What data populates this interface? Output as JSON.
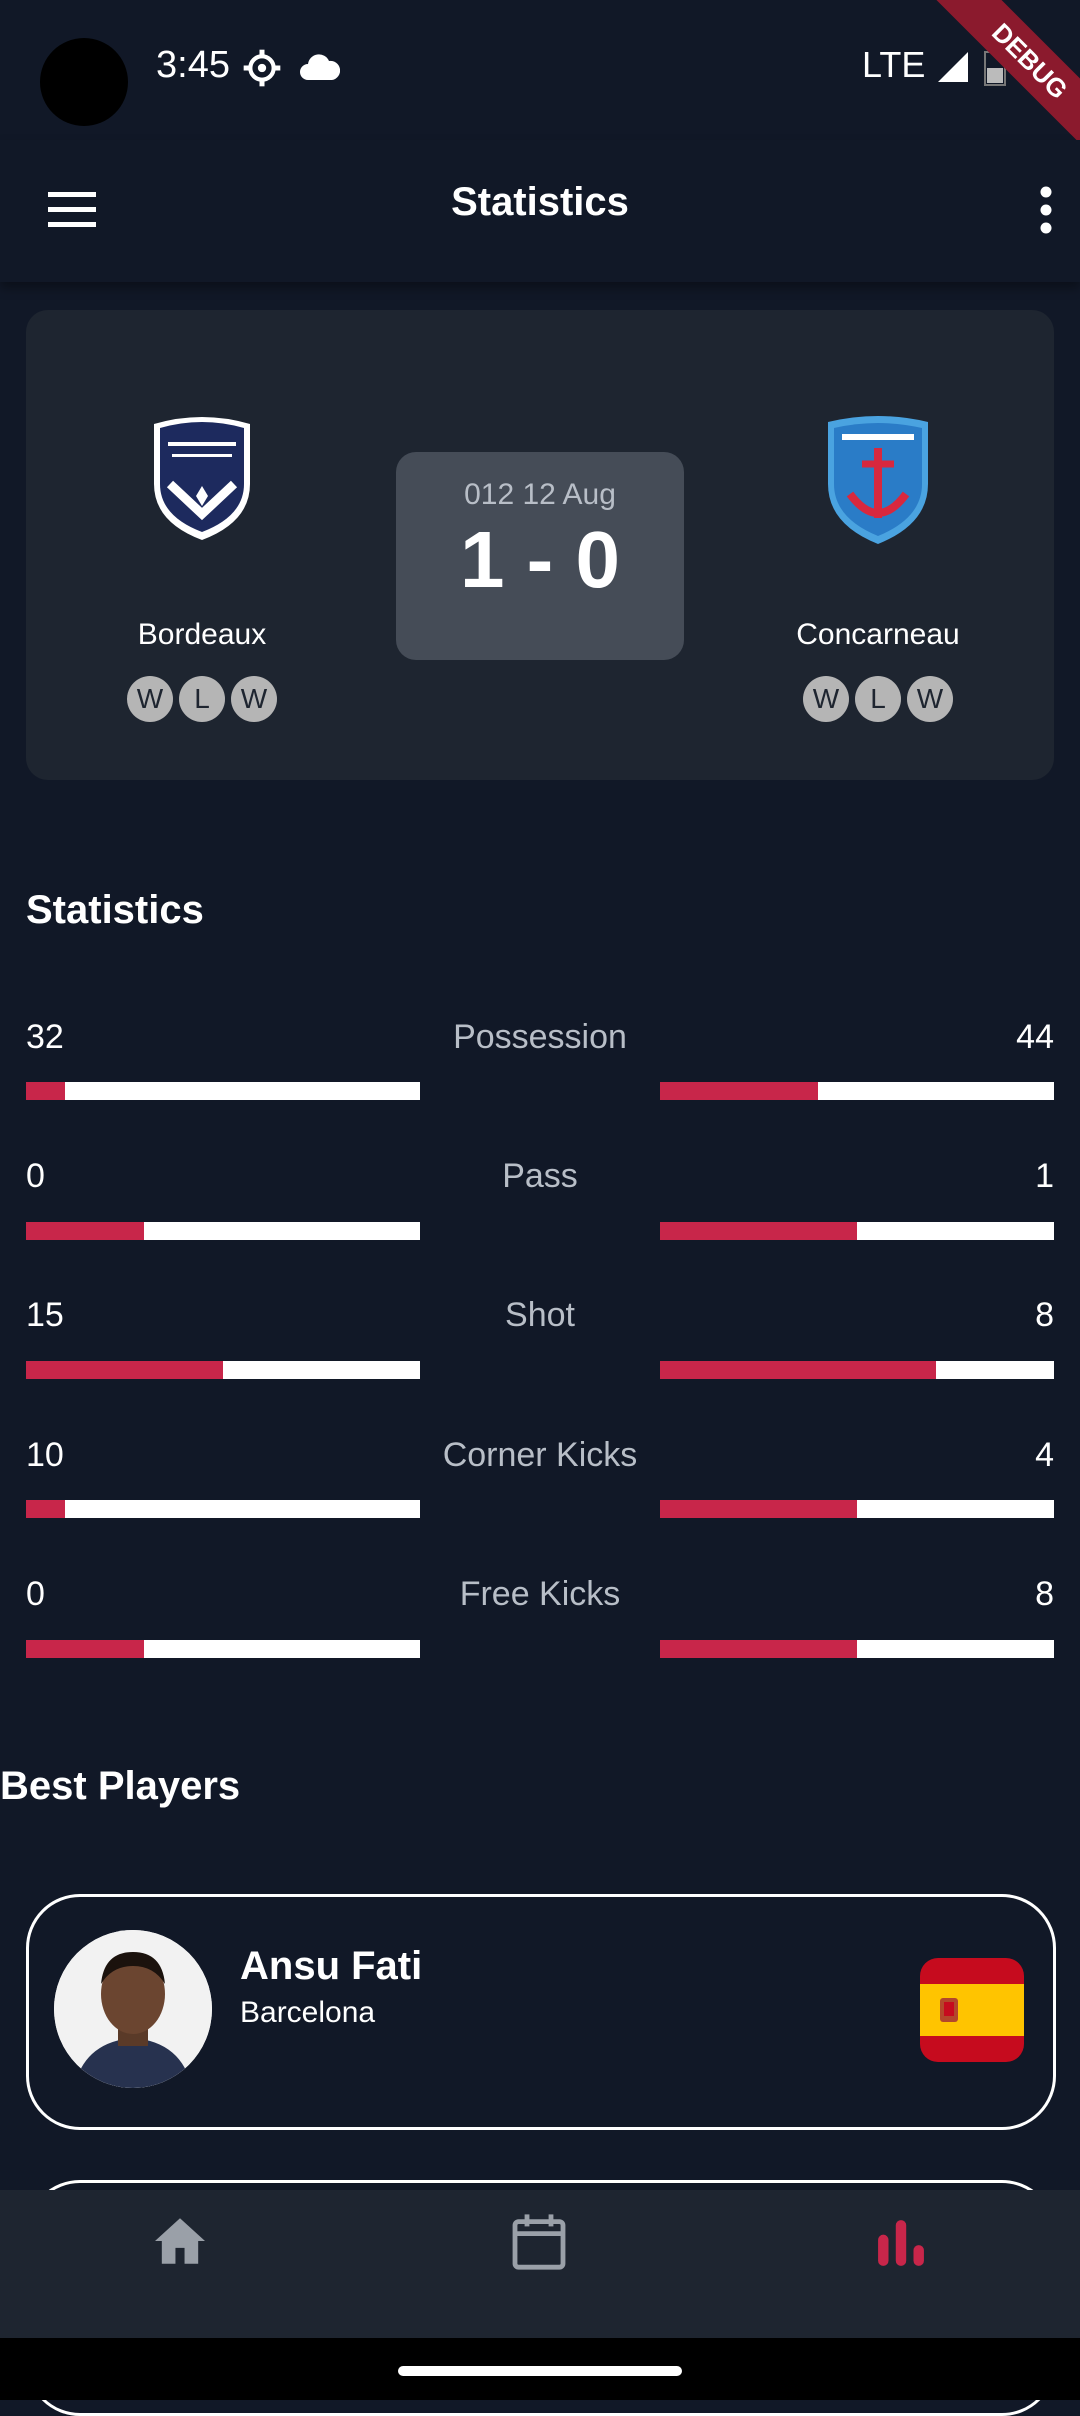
{
  "status_bar": {
    "time": "3:45",
    "network": "LTE",
    "debug_label": "DEBUG"
  },
  "app_bar": {
    "title": "Statistics"
  },
  "match": {
    "date": "012 12 Aug",
    "score": "1 - 0",
    "home": {
      "name": "Bordeaux",
      "form": [
        "W",
        "L",
        "W"
      ]
    },
    "away": {
      "name": "Concarneau",
      "form": [
        "W",
        "L",
        "W"
      ]
    }
  },
  "statistics": {
    "title": "Statistics",
    "rows": [
      {
        "label": "Possession",
        "home": "32",
        "away": "44",
        "home_fill": 0.1,
        "away_fill": 0.4
      },
      {
        "label": "Pass",
        "home": "0",
        "away": "1",
        "home_fill": 0.3,
        "away_fill": 0.5
      },
      {
        "label": "Shot",
        "home": "15",
        "away": "8",
        "home_fill": 0.5,
        "away_fill": 0.7
      },
      {
        "label": "Corner Kicks",
        "home": "10",
        "away": "4",
        "home_fill": 0.1,
        "away_fill": 0.5
      },
      {
        "label": "Free Kicks",
        "home": "0",
        "away": "8",
        "home_fill": 0.3,
        "away_fill": 0.5
      }
    ]
  },
  "best_players": {
    "title": "Best Players",
    "players": [
      {
        "name": "Ansu Fati",
        "club": "Barcelona",
        "flag": "spain-flag"
      }
    ]
  },
  "bottom_nav": {
    "items": [
      {
        "icon": "home-icon",
        "active": false
      },
      {
        "icon": "calendar-icon",
        "active": false
      },
      {
        "icon": "bar-chart-icon",
        "active": true
      }
    ]
  },
  "colors": {
    "accent": "#c8264a",
    "background": "#111827",
    "card": "#1e2530"
  }
}
